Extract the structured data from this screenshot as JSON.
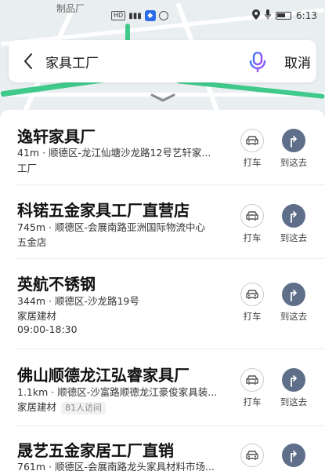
{
  "status_bar": {
    "time": "6:13",
    "badge": "HD"
  },
  "map": {
    "label": "制品厂"
  },
  "search": {
    "query": "家具工厂",
    "cancel_label": "取消"
  },
  "actions": {
    "taxi_label": "打车",
    "nav_label": "到这去"
  },
  "results": [
    {
      "name": "逸轩家具厂",
      "distance": "41m",
      "address": "顺德区-龙江仙塘沙龙路12号艺轩家...",
      "category": "工厂",
      "hours": "",
      "visits": ""
    },
    {
      "name": "科锘五金家具工厂直营店",
      "distance": "745m",
      "address": "顺德区-会展南路亚洲国际物流中心",
      "category": "五金店",
      "hours": "",
      "visits": ""
    },
    {
      "name": "英航不锈钢",
      "distance": "344m",
      "address": "顺德区-沙龙路19号",
      "category": "家居建材",
      "hours": "09:00-18:30",
      "visits": ""
    },
    {
      "name": "佛山顺德龙江弘睿家具厂",
      "distance": "1.1km",
      "address": "顺德区-沙富路顺德龙江豪俊家具装...",
      "category": "家居建材",
      "hours": "",
      "visits": "81人访问"
    },
    {
      "name": "晟艺五金家居工厂直销",
      "distance": "761m",
      "address": "顺德区-会展南路龙头家具材料市场...",
      "category": "",
      "hours": "",
      "visits": ""
    }
  ],
  "colors": {
    "nav_button": "#5f6f8a",
    "map_green": "#3fc98a",
    "mic_gradient": [
      "#3b7cff",
      "#b44cff"
    ]
  }
}
